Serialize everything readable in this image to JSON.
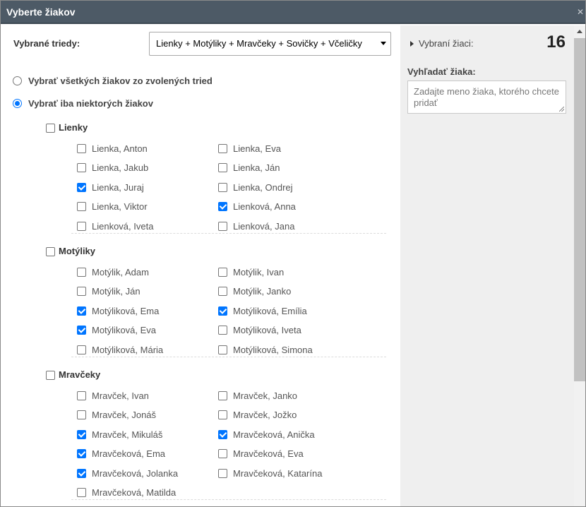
{
  "dialog": {
    "title": "Vyberte žiakov",
    "close_label": "✕"
  },
  "classes": {
    "label": "Vybrané triedy:",
    "selected": "Lienky + Motýliky + Mravčeky + Sovičky + Včeličky"
  },
  "mode": {
    "all_label": "Vybrať všetkých žiakov zo zvolených tried",
    "some_label": "Vybrať iba niektorých žiakov",
    "selected": "some"
  },
  "groups": [
    {
      "name": "Lienky",
      "checked": false,
      "students": [
        {
          "name": "Lienka, Anton",
          "checked": false
        },
        {
          "name": "Lienka, Eva",
          "checked": false
        },
        {
          "name": "Lienka, Jakub",
          "checked": false
        },
        {
          "name": "Lienka, Ján",
          "checked": false
        },
        {
          "name": "Lienka, Juraj",
          "checked": true
        },
        {
          "name": "Lienka, Ondrej",
          "checked": false
        },
        {
          "name": "Lienka, Viktor",
          "checked": false
        },
        {
          "name": "Lienková, Anna",
          "checked": true
        },
        {
          "name": "Lienková, Iveta",
          "checked": false
        },
        {
          "name": "Lienková, Jana",
          "checked": false
        }
      ]
    },
    {
      "name": "Motýliky",
      "checked": false,
      "students": [
        {
          "name": "Motýlik, Adam",
          "checked": false
        },
        {
          "name": "Motýlik, Ivan",
          "checked": false
        },
        {
          "name": "Motýlik, Ján",
          "checked": false
        },
        {
          "name": "Motýlik, Janko",
          "checked": false
        },
        {
          "name": "Motýliková, Ema",
          "checked": true
        },
        {
          "name": "Motýliková, Emília",
          "checked": true
        },
        {
          "name": "Motýliková, Eva",
          "checked": true
        },
        {
          "name": "Motýliková, Iveta",
          "checked": false
        },
        {
          "name": "Motýliková, Mária",
          "checked": false
        },
        {
          "name": "Motýliková, Simona",
          "checked": false
        }
      ]
    },
    {
      "name": "Mravčeky",
      "checked": false,
      "students": [
        {
          "name": "Mravček, Ivan",
          "checked": false
        },
        {
          "name": "Mravček, Janko",
          "checked": false
        },
        {
          "name": "Mravček, Jonáš",
          "checked": false
        },
        {
          "name": "Mravček, Jožko",
          "checked": false
        },
        {
          "name": "Mravček, Mikuláš",
          "checked": true
        },
        {
          "name": "Mravčeková, Anička",
          "checked": true
        },
        {
          "name": "Mravčeková, Ema",
          "checked": true
        },
        {
          "name": "Mravčeková, Eva",
          "checked": false
        },
        {
          "name": "Mravčeková, Jolanka",
          "checked": true
        },
        {
          "name": "Mravčeková, Katarína",
          "checked": false
        },
        {
          "name": "Mravčeková, Matilda",
          "checked": false
        }
      ]
    }
  ],
  "selected_panel": {
    "toggle_label": "Vybraní žiaci:",
    "count": "16",
    "search_label": "Vyhľadať žiaka:",
    "search_placeholder": "Zadajte meno žiaka, ktorého chcete pridať",
    "search_value": ""
  }
}
